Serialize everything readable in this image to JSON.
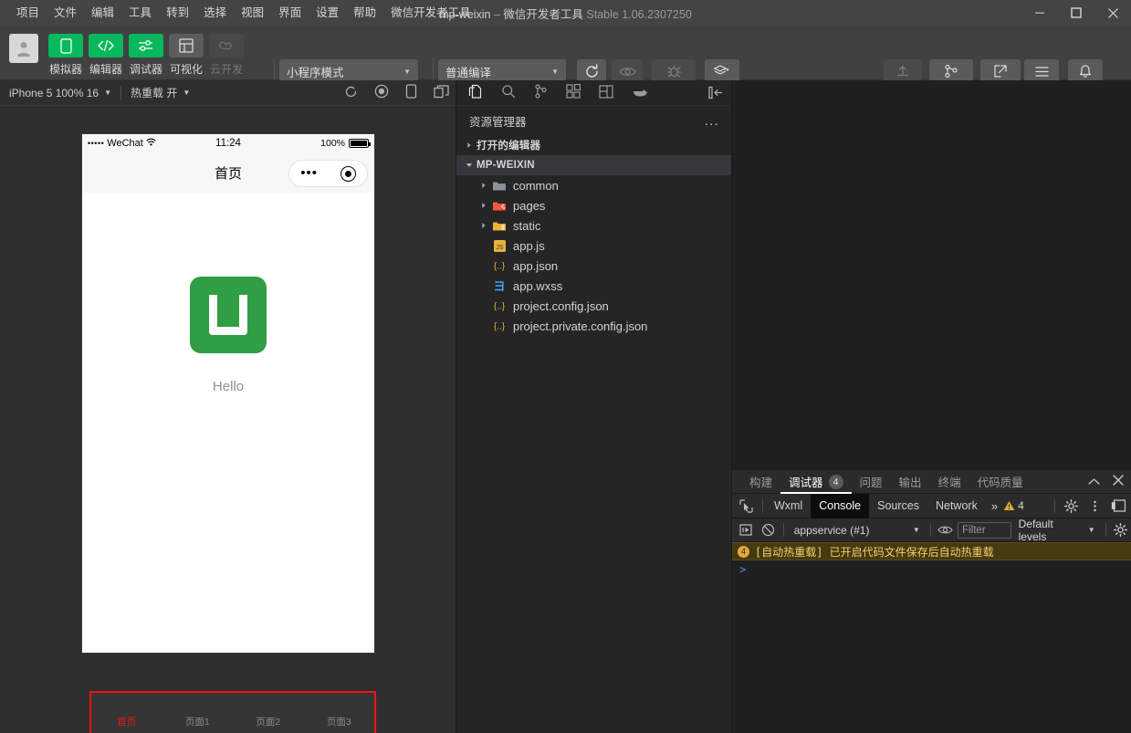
{
  "titlebar": {
    "menu": [
      "项目",
      "文件",
      "编辑",
      "工具",
      "转到",
      "选择",
      "视图",
      "界面",
      "设置",
      "帮助",
      "微信开发者工具"
    ],
    "project_name": "mp-weixin",
    "dash": "–",
    "app_name": "微信开发者工具",
    "version": "Stable 1.06.2307250",
    "minimize": "minimize-icon",
    "maximize": "maximize-icon",
    "close": "close-icon"
  },
  "toolbar": {
    "avatar": "user-avatar-icon",
    "modes": [
      {
        "label": "模拟器",
        "icon": "phone-icon",
        "state": "green"
      },
      {
        "label": "编辑器",
        "icon": "code-icon",
        "state": "green"
      },
      {
        "label": "调试器",
        "icon": "sliders-icon",
        "state": "green"
      },
      {
        "label": "可视化",
        "icon": "layout-icon",
        "state": "grey"
      },
      {
        "label": "云开发",
        "icon": "cloud-icon",
        "state": "dim"
      }
    ],
    "mode_select": "小程序模式",
    "compile_select": "普通编译",
    "compile_label": "编译",
    "preview_label": "预览",
    "remote_debug_label": "真机调试",
    "clear_cache_label": "清缓存",
    "right_actions": [
      {
        "label": "上传",
        "icon": "upload-icon",
        "state": "dim"
      },
      {
        "label": "版本管理",
        "icon": "branch-icon",
        "state": "normal"
      },
      {
        "label": "测试号",
        "icon": "external-link-icon",
        "state": "normal"
      },
      {
        "label": "详情",
        "icon": "menu-lines-icon",
        "state": "normal"
      },
      {
        "label": "消息",
        "icon": "bell-icon",
        "state": "normal"
      }
    ]
  },
  "simulator": {
    "device_select": "iPhone 5 100% 16",
    "hotreload_select": "热重载 开",
    "icons": [
      "refresh-icon",
      "record-icon",
      "rotate-device-icon",
      "multi-window-icon"
    ],
    "status": {
      "carrier_dots": "•••••",
      "carrier": "WeChat",
      "wifi": "wifi-icon",
      "time": "11:24",
      "battery_pct": "100%"
    },
    "nav_title": "首页",
    "capsule_dots": "•••",
    "capsule_target": "target-icon",
    "hello": "Hello",
    "logo": "uniapp-logo",
    "tabs": [
      {
        "label": "首页",
        "active": true
      },
      {
        "label": "页面1",
        "active": false
      },
      {
        "label": "页面2",
        "active": false
      },
      {
        "label": "页面3",
        "active": false
      }
    ]
  },
  "explorer": {
    "toolbar_icons": [
      "files-icon",
      "search-icon",
      "source-control-icon",
      "extensions-icon",
      "layout-panel-icon",
      "docker-icon",
      "collapse-sidebar-icon"
    ],
    "title": "资源管理器",
    "more": "...",
    "open_editors": "打开的编辑器",
    "project_root": "MP-WEIXIN",
    "nodes": [
      {
        "name": "common",
        "type": "folder",
        "color": "#8a9199",
        "depth": 1,
        "expandable": true
      },
      {
        "name": "pages",
        "type": "folder",
        "color": "#f05a3c",
        "depth": 1,
        "expandable": true
      },
      {
        "name": "static",
        "type": "folder",
        "color": "#e8b339",
        "depth": 1,
        "expandable": true
      },
      {
        "name": "app.js",
        "type": "js",
        "color": "#e8b339",
        "depth": 1,
        "expandable": false
      },
      {
        "name": "app.json",
        "type": "json",
        "color": "#e8b339",
        "depth": 1,
        "expandable": false
      },
      {
        "name": "app.wxss",
        "type": "wxss",
        "color": "#42a5f5",
        "depth": 1,
        "expandable": false
      },
      {
        "name": "project.config.json",
        "type": "json",
        "color": "#e8b339",
        "depth": 1,
        "expandable": false
      },
      {
        "name": "project.private.config.json",
        "type": "json",
        "color": "#e8b339",
        "depth": 1,
        "expandable": false
      }
    ]
  },
  "debugger": {
    "panel_tabs": [
      {
        "label": "构建",
        "active": false,
        "count": null
      },
      {
        "label": "调试器",
        "active": true,
        "count": "4"
      },
      {
        "label": "问题",
        "active": false,
        "count": null
      },
      {
        "label": "输出",
        "active": false,
        "count": null
      },
      {
        "label": "终端",
        "active": false,
        "count": null
      },
      {
        "label": "代码质量",
        "active": false,
        "count": null
      }
    ],
    "collapse_icon": "chevron-up-icon",
    "close_icon": "close-icon",
    "devtools_tabs": [
      {
        "label": "Wxml",
        "active": false
      },
      {
        "label": "Console",
        "active": true
      },
      {
        "label": "Sources",
        "active": false
      },
      {
        "label": "Network",
        "active": false
      }
    ],
    "more_tabs": "»",
    "warning_count": "4",
    "settings_icon": "gear-icon",
    "kebab_icon": "more-vertical-icon",
    "dock_icon": "dock-icon",
    "console": {
      "execute_icon": "run-icon",
      "clear_icon": "clear-console-icon",
      "context": "appservice (#1)",
      "eye_icon": "eye-icon",
      "filter_placeholder": "Filter",
      "levels": "Default levels",
      "gear_icon": "gear-icon",
      "messages": [
        {
          "level": "warning",
          "count": "4",
          "text": "[自动热重载] 已开启代码文件保存后自动热重载"
        }
      ],
      "prompt": ">"
    }
  },
  "colors": {
    "wechat_green": "#07b85c",
    "accent_red": "#ef1414",
    "warn_yellow": "#e2a93b"
  }
}
